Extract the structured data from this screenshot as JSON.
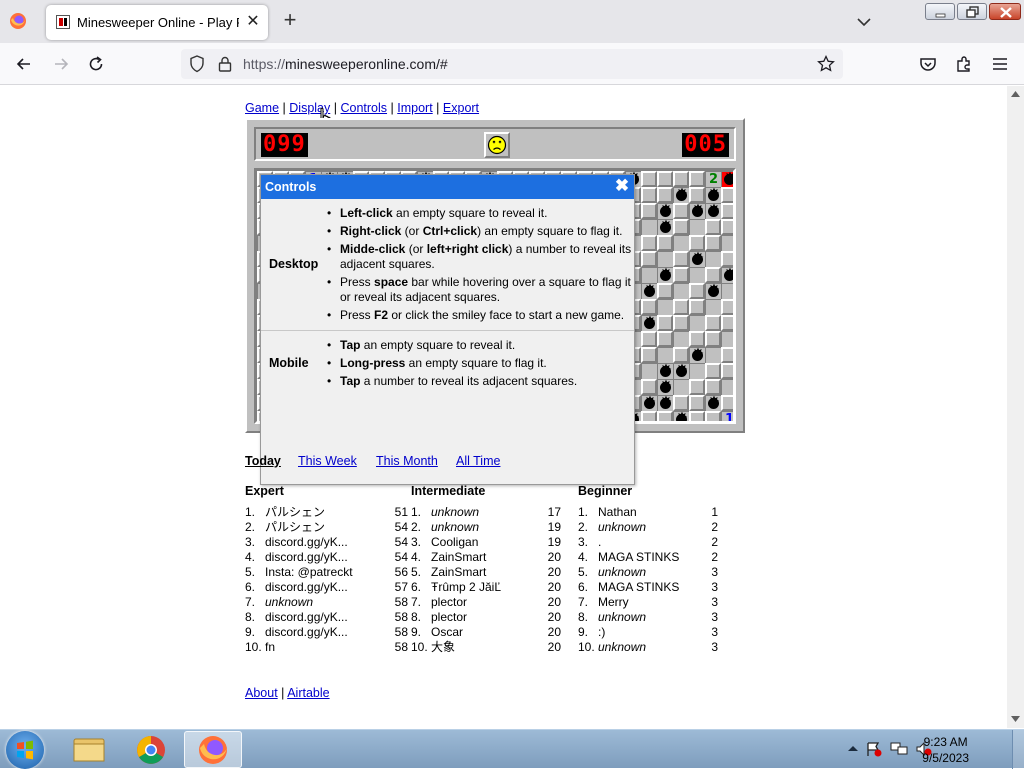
{
  "browser": {
    "tab_title": "Minesweeper Online - Play Free",
    "url_prefix": "https://",
    "url_rest": "minesweeperonline.com/#",
    "new_tab_symbol": "+",
    "tab_close_symbol": "✕"
  },
  "menu": {
    "game": "Game",
    "display": "Display",
    "controls": "Controls",
    "import": "Import",
    "export": "Export",
    "sep": "|"
  },
  "game": {
    "mines_left": "099",
    "timer": "005"
  },
  "controls_dialog": {
    "title": "Controls",
    "close_symbol": "✖",
    "desktop_label": "Desktop",
    "mobile_label": "Mobile",
    "desktop_items": [
      [
        "Left-click",
        " an empty square to reveal it."
      ],
      [
        "Right-click",
        " (or ",
        "Ctrl+click",
        ") an empty square to flag it."
      ],
      [
        "Midde-click",
        " (or ",
        "left+right click",
        ") a number to reveal its adjacent squares."
      ],
      [
        "Press ",
        "space",
        " bar while hovering over a square to flag it or reveal its adjacent squares."
      ],
      [
        "Press ",
        "F2",
        " or click the smiley face to start a new game."
      ]
    ],
    "mobile_items": [
      [
        "Tap",
        " an empty square to reveal it."
      ],
      [
        "Long-press",
        " an empty square to flag it."
      ],
      [
        "Tap",
        " a number to reveal its adjacent squares."
      ]
    ]
  },
  "board_numbers": {
    "n_left": "1",
    "n_two": "2",
    "n_one_bottom": "1"
  },
  "periods": {
    "today": "Today",
    "week": "This Week",
    "month": "This Month",
    "all": "All Time"
  },
  "leaderboards": [
    {
      "title": "Expert",
      "rows": [
        {
          "rank": "1.",
          "name": "パルシェン",
          "score": "51",
          "italic": false
        },
        {
          "rank": "2.",
          "name": "パルシェン",
          "score": "54",
          "italic": false
        },
        {
          "rank": "3.",
          "name": "discord.gg/yK...",
          "score": "54",
          "italic": false
        },
        {
          "rank": "4.",
          "name": "discord.gg/yK...",
          "score": "54",
          "italic": false
        },
        {
          "rank": "5.",
          "name": "Insta: @patreckt",
          "score": "56",
          "italic": false
        },
        {
          "rank": "6.",
          "name": "discord.gg/yK...",
          "score": "57",
          "italic": false
        },
        {
          "rank": "7.",
          "name": "unknown",
          "score": "58",
          "italic": true
        },
        {
          "rank": "8.",
          "name": "discord.gg/yK...",
          "score": "58",
          "italic": false
        },
        {
          "rank": "9.",
          "name": "discord.gg/yK...",
          "score": "58",
          "italic": false
        },
        {
          "rank": "10.",
          "name": "fn",
          "score": "58",
          "italic": false
        }
      ]
    },
    {
      "title": "Intermediate",
      "rows": [
        {
          "rank": "1.",
          "name": "unknown",
          "score": "17",
          "italic": true
        },
        {
          "rank": "2.",
          "name": "unknown",
          "score": "19",
          "italic": true
        },
        {
          "rank": "3.",
          "name": "Cooligan",
          "score": "19",
          "italic": false
        },
        {
          "rank": "4.",
          "name": "ZainSmart",
          "score": "20",
          "italic": false
        },
        {
          "rank": "5.",
          "name": "ZainSmart",
          "score": "20",
          "italic": false
        },
        {
          "rank": "6.",
          "name": "Ŧrûmp 2 JăiĽ",
          "score": "20",
          "italic": false
        },
        {
          "rank": "7.",
          "name": "plector",
          "score": "20",
          "italic": false
        },
        {
          "rank": "8.",
          "name": "plector",
          "score": "20",
          "italic": false
        },
        {
          "rank": "9.",
          "name": "Oscar",
          "score": "20",
          "italic": false
        },
        {
          "rank": "10.",
          "name": "大象",
          "score": "20",
          "italic": false
        }
      ]
    },
    {
      "title": "Beginner",
      "rows": [
        {
          "rank": "1.",
          "name": "Nathan",
          "score": "1",
          "italic": false
        },
        {
          "rank": "2.",
          "name": "unknown",
          "score": "2",
          "italic": true
        },
        {
          "rank": "3.",
          "name": ".",
          "score": "2",
          "italic": false
        },
        {
          "rank": "4.",
          "name": "MAGA STINKS",
          "score": "2",
          "italic": false
        },
        {
          "rank": "5.",
          "name": "unknown",
          "score": "3",
          "italic": true
        },
        {
          "rank": "6.",
          "name": "MAGA STINKS",
          "score": "3",
          "italic": false
        },
        {
          "rank": "7.",
          "name": "Merry",
          "score": "3",
          "italic": false
        },
        {
          "rank": "8.",
          "name": "unknown",
          "score": "3",
          "italic": true
        },
        {
          "rank": "9.",
          "name": ":)",
          "score": "3",
          "italic": false
        },
        {
          "rank": "10.",
          "name": "unknown",
          "score": "3",
          "italic": true
        }
      ]
    }
  ],
  "footer": {
    "about": "About",
    "airtable": "Airtable",
    "sep": "|"
  },
  "taskbar": {
    "time": "9:23 AM",
    "date": "9/5/2023"
  },
  "colors": {
    "link": "#0000cc",
    "dialog_header": "#1d6fe0",
    "lcd_digit": "#ff0000"
  }
}
